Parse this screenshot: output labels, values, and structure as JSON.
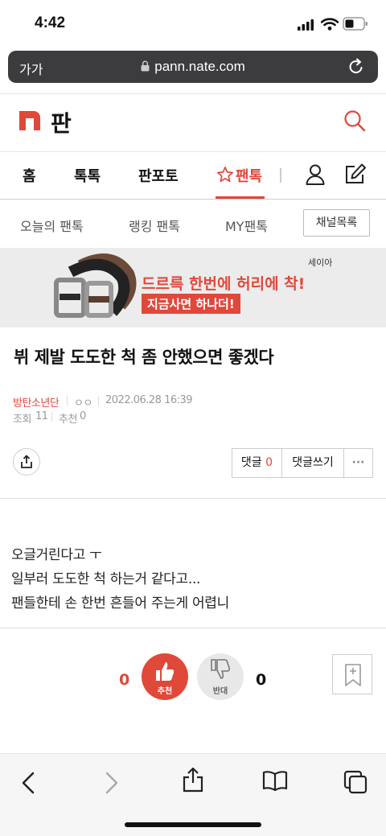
{
  "status_bar": {
    "time": "4:42"
  },
  "browser": {
    "text_size_label": "가가",
    "url": "pann.nate.com"
  },
  "header": {
    "logo_text": "판",
    "brand_color": "#e0483a"
  },
  "nav": {
    "items": [
      "홈",
      "톡톡",
      "판포토",
      "팬톡"
    ],
    "active": "팬톡"
  },
  "subnav": {
    "items": [
      "오늘의 팬톡",
      "랭킹 팬톡",
      "MY팬톡"
    ],
    "channel_button": "채널목록"
  },
  "banner": {
    "headline": "드르륵 한번에 허리에 착!",
    "cta": "지금사면 하나더!",
    "brand": "세이아"
  },
  "post": {
    "title": "뷔 제발 도도한 척 좀 안했으면 좋겠다",
    "author": "방탄소년단",
    "nickname": "ㅇㅇ",
    "date": "2022.06.28 16:39",
    "views_label": "조회",
    "views": "11",
    "recommend_label": "추천",
    "recommend": "0",
    "body": [
      "오글거린다고 ㅜ",
      "일부러 도도한 척 하는거 같다고...",
      "팬들한테 손 한번 흔들어 주는게 어렵니"
    ]
  },
  "comments": {
    "label": "댓글",
    "count": "0",
    "write_label": "댓글쓰기",
    "more": "···"
  },
  "votes": {
    "recommend_count": "0",
    "recommend_label": "추천",
    "oppose_count": "0",
    "oppose_label": "반대"
  }
}
